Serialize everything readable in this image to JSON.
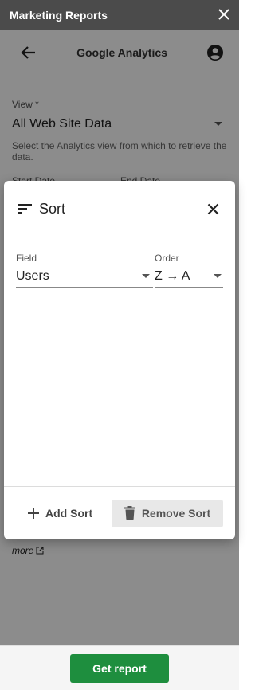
{
  "window": {
    "title": "Marketing Reports"
  },
  "header": {
    "title": "Google Analytics"
  },
  "view": {
    "label": "View *",
    "value": "All Web Site Data",
    "help": "Select the Analytics view from which to retrieve the data."
  },
  "dates": {
    "start_label": "Start Date",
    "end_label": "End Date"
  },
  "more_link": "more",
  "footer": {
    "get_report_label": "Get report"
  },
  "sort_dialog": {
    "title": "Sort",
    "field_label": "Field",
    "field_value": "Users",
    "order_label": "Order",
    "order_value": "Z → A",
    "add_sort_label": "Add Sort",
    "remove_sort_label": "Remove Sort"
  },
  "colors": {
    "primary": "#1e8e3e",
    "titlebar": "#4b4b4b"
  }
}
